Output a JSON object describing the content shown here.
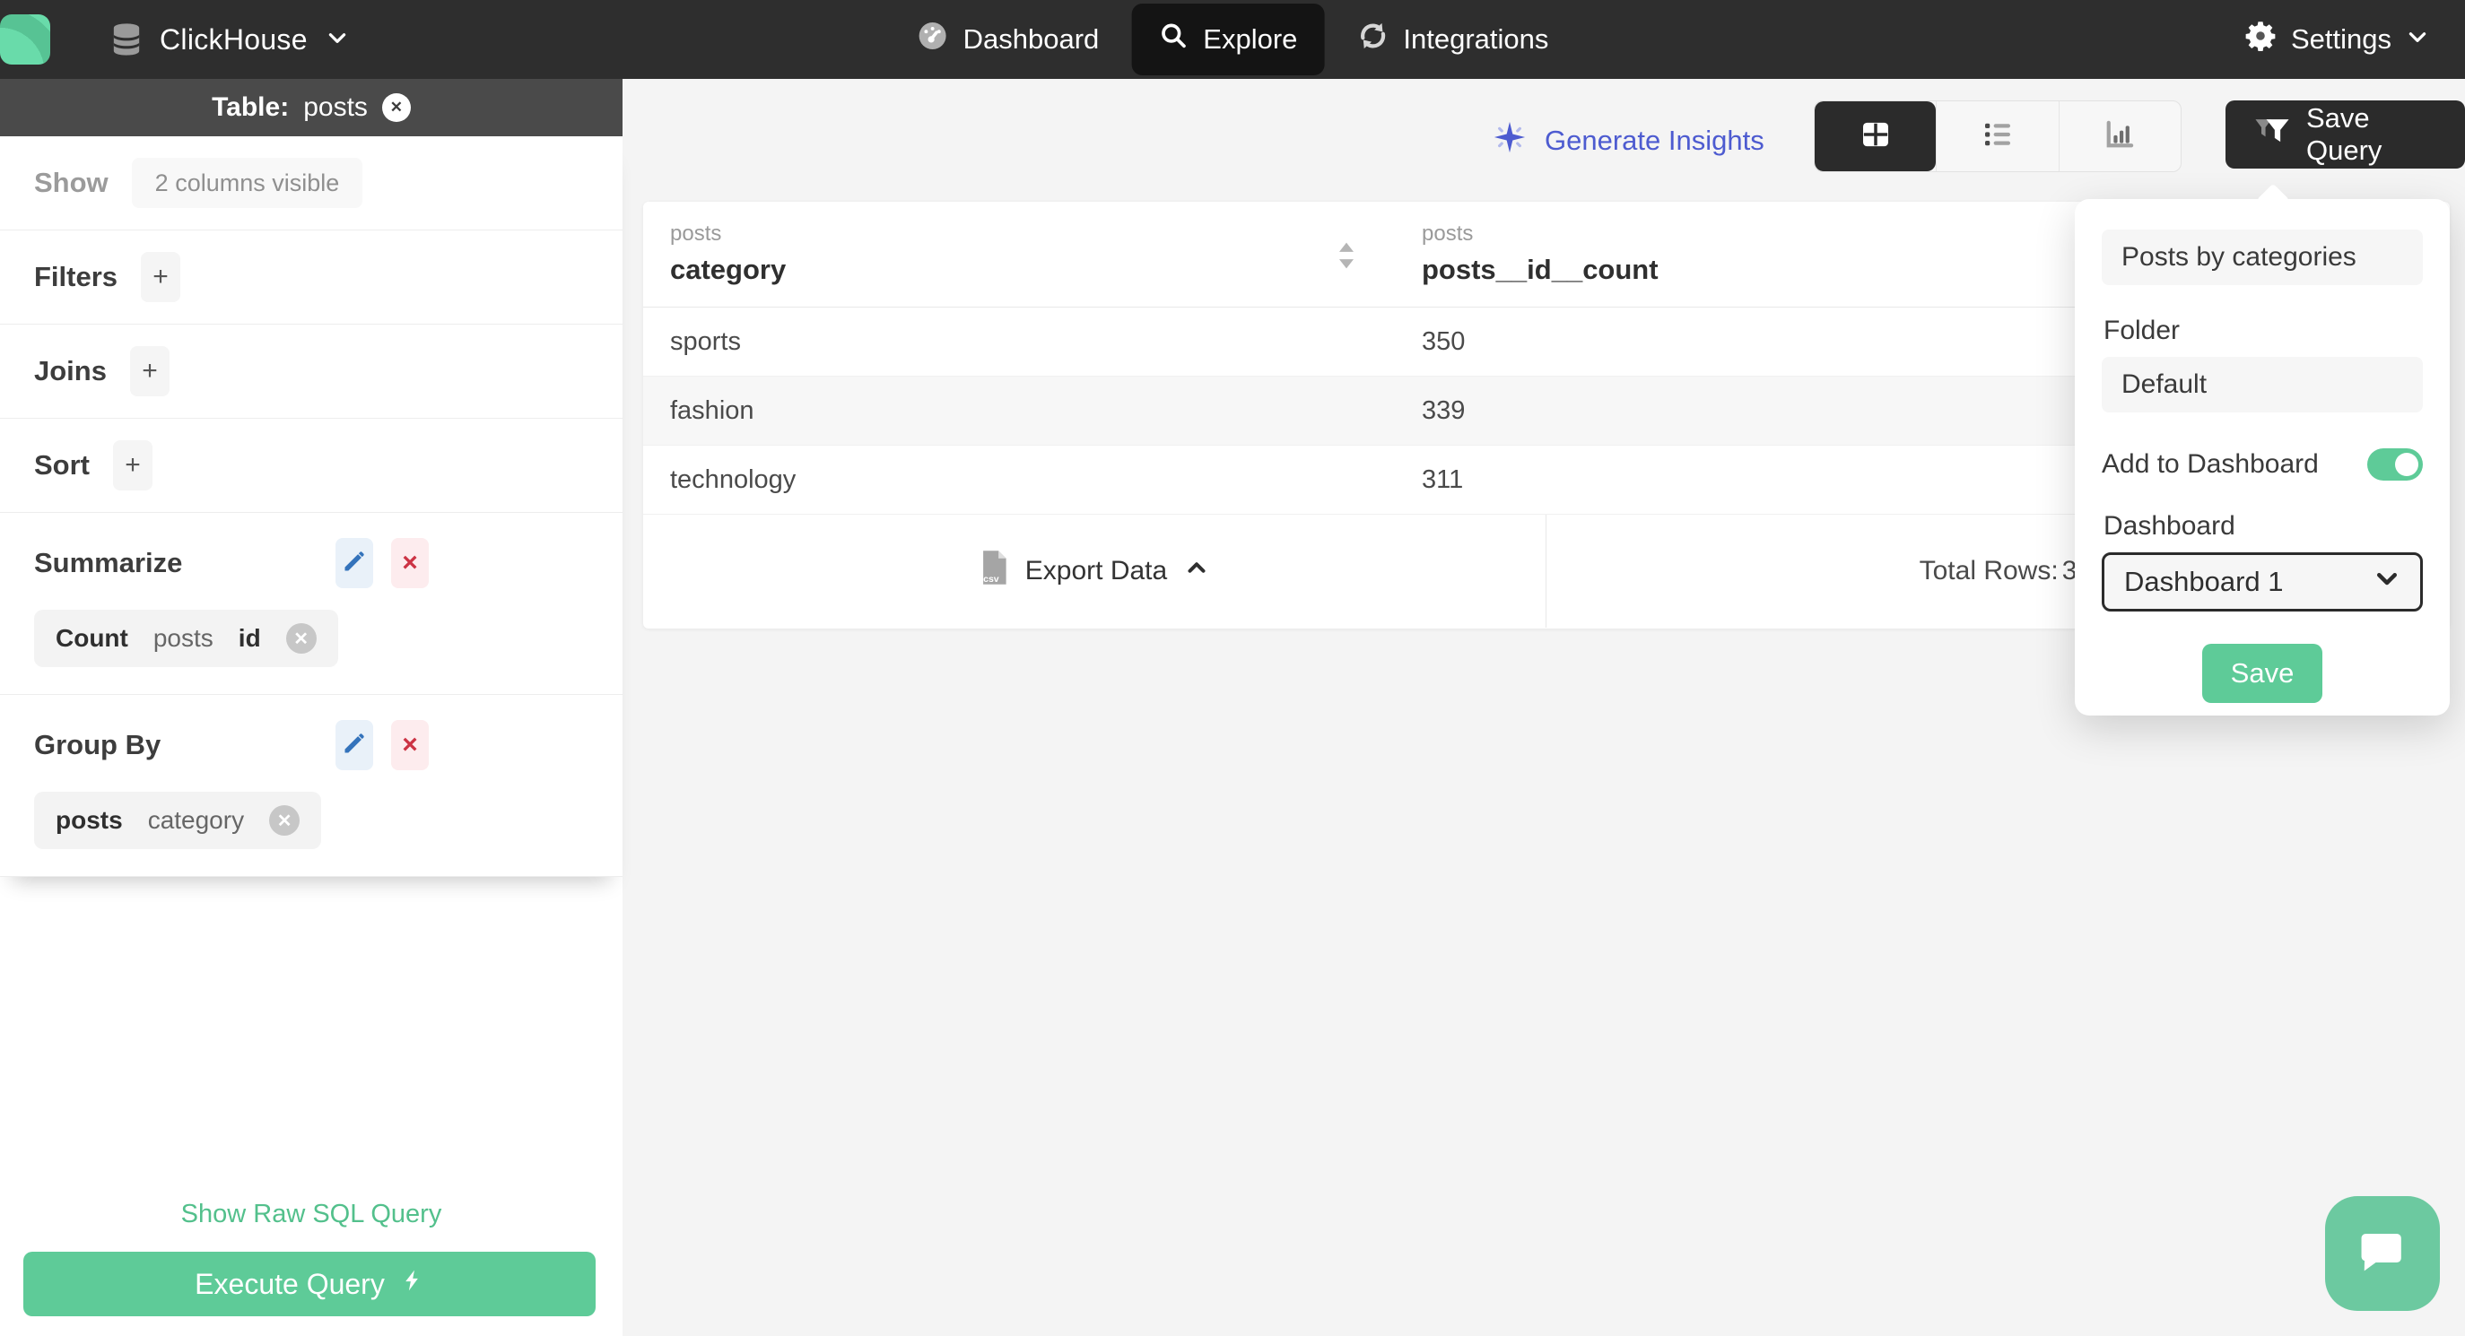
{
  "topbar": {
    "brand": "ClickHouse",
    "nav_dashboard": "Dashboard",
    "nav_explore": "Explore",
    "nav_integrations": "Integrations",
    "settings": "Settings"
  },
  "sidebar": {
    "table_prefix": "Table:",
    "table_name": "posts",
    "show_label": "Show",
    "show_value": "2 columns visible",
    "filters_label": "Filters",
    "joins_label": "Joins",
    "sort_label": "Sort",
    "add_symbol": "+",
    "summarize_label": "Summarize",
    "summarize_chip": {
      "agg": "Count",
      "table": "posts",
      "column": "id"
    },
    "group_by_label": "Group By",
    "group_by_chip": {
      "table": "posts",
      "column": "category"
    },
    "raw_sql_link": "Show Raw SQL Query",
    "execute_button": "Execute Query"
  },
  "toolbar": {
    "generate_insights": "Generate Insights",
    "save_query": "Save Query"
  },
  "results": {
    "columns": [
      {
        "group": "posts",
        "name": "category"
      },
      {
        "group": "posts",
        "name": "posts__id__count"
      }
    ],
    "rows": [
      {
        "category": "sports",
        "count": "350"
      },
      {
        "category": "fashion",
        "count": "339"
      },
      {
        "category": "technology",
        "count": "311"
      }
    ],
    "export_label": "Export Data",
    "total_rows_label": "Total Rows:",
    "total_rows_value": "3"
  },
  "save_popover": {
    "query_name": "Posts by categories",
    "folder_label": "Folder",
    "folder_value": "Default",
    "add_to_dashboard_label": "Add to Dashboard",
    "dashboard_label": "Dashboard",
    "dashboard_value": "Dashboard 1",
    "save_button": "Save"
  },
  "colors": {
    "accent_green": "#5ecb98",
    "accent_indigo": "#4d5bd0",
    "topbar_dark": "#2e2e2e",
    "table_bar_gray": "#4a4a4a",
    "main_bg": "#f4f4f4"
  }
}
